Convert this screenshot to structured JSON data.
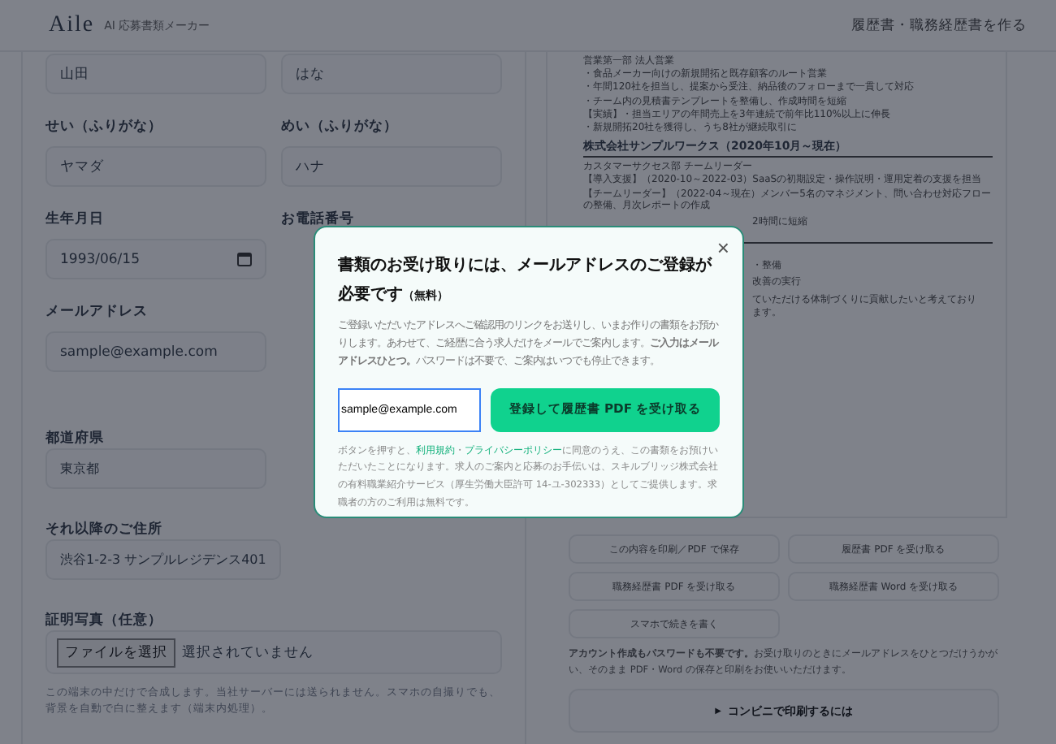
{
  "header": {
    "logo": "Aile",
    "tagline": "AI 応募書類メーカー",
    "nav_link": "履歴書・職務経歴書を作る"
  },
  "form": {
    "top_fields": [
      {
        "value": "山田"
      },
      {
        "value": "はな"
      }
    ],
    "rows": [
      {
        "label": "せい（ふりがな）",
        "value": "ヤマダ",
        "label2": "めい（ふりがな）",
        "value2": "ハナ"
      },
      {
        "label": "生年月日",
        "value": "1993/06/15",
        "kind": "date",
        "label2": "お電話番号"
      },
      {
        "label": "メールアドレス",
        "value": "sample@example.com"
      }
    ],
    "prefecture": {
      "label": "都道府県",
      "value": "東京都"
    },
    "address": {
      "label": "それ以降のご住所",
      "value": "渋谷1-2-3 サンプルレジデンス401"
    },
    "photo": {
      "label": "証明写真（任意）",
      "button": "ファイルを選択",
      "status": "選択されていません",
      "hint": "この端末の中だけで合成します。当社サーバーには送られません。スマホの自撮りでも、背景を自動で白に整えます（端末内処理）。"
    }
  },
  "preview": {
    "lines": [
      {
        "kind": "text",
        "text": "営業第一部 法人営業"
      },
      {
        "kind": "text",
        "text": "・食品メーカー向けの新規開拓と既存顧客のルート営業"
      },
      {
        "kind": "text",
        "text": "・年間120社を担当し、提案から受注、納品後のフォローまで一貫して対応"
      },
      {
        "kind": "text",
        "text": "・チーム内の見積書テンプレートを整備し、作成時間を短縮"
      },
      {
        "kind": "text",
        "text": "【実績】・担当エリアの年間売上を3年連続で前年比110%以上に伸長"
      },
      {
        "kind": "text",
        "text": "・新規開拓20社を獲得し、うち8社が継続取引に"
      },
      {
        "kind": "heading",
        "text": "株式会社サンプルワークス（2020年10月～現在）"
      },
      {
        "kind": "text",
        "text": "カスタマーサクセス部 チームリーダー"
      },
      {
        "kind": "text",
        "text": "【導入支援】（2020-10～2022-03）SaaSの初期設定・操作説明・運用定着の支援を担当"
      },
      {
        "kind": "text",
        "text": "【チームリーダー】（2022-04～現在）メンバー5名のマネジメント、問い合わせ対応フローの整備、月次レポートの作成"
      },
      {
        "kind": "partial",
        "text": "2時間に短縮"
      },
      {
        "kind": "rule"
      },
      {
        "kind": "partial",
        "text": "・整備"
      },
      {
        "kind": "partial",
        "text": "改善の実行"
      },
      {
        "kind": "partial",
        "text": "ていただける体制づくりに貢献したいと考えております。"
      }
    ]
  },
  "actions": [
    {
      "label": "この内容を印刷／PDF で保存"
    },
    {
      "label": "履歴書 PDF を受け取る"
    },
    {
      "label": "職務経歴書 PDF を受け取る"
    },
    {
      "label": "職務経歴書 Word を受け取る"
    },
    {
      "label": "スマホで続きを書く"
    }
  ],
  "account_note": "**アカウント作成もパスワードも不要です。**お受け取りのときにメールアドレスをひとつだけうかがい、そのまま PDF・Word の保存と印刷をお使いいただけます。",
  "konbini": {
    "icon": "▶",
    "label": "コンビニで印刷するには",
    "expanded": false
  },
  "modal": {
    "title": "書類のお受け取りには、メールアドレスのご登録が必要です",
    "title_note": "（無料）",
    "close": "×",
    "body": "ご登録いただいたアドレスへご確認用のリンクをお送りし、いまお作りの書類をお預かりします。あわせて、ご経歴に合う求人だけをメールでご案内します。**ご入力はメールアドレスひとつ。**パスワードは不要で、ご案内はいつでも停止できます。",
    "email": "sample@example.com",
    "submit": "登録して履歴書 PDF を受け取る",
    "legal": [
      {
        "kind": "text",
        "text": "ボタンを押すと、"
      },
      {
        "kind": "link",
        "text": "利用規約"
      },
      {
        "kind": "text",
        "text": "・"
      },
      {
        "kind": "link",
        "text": "プライバシーポリシー"
      },
      {
        "kind": "text",
        "text": "に同意のうえ、この書類をお預けいただいたことになります。求人のご案内と応募のお手伝いは、スキルブリッジ株式会社の有料職業紹介サービス（厚生労働大臣許可 14-ユ-302333）としてご提供します。求職者の方のご利用は無料です。"
      }
    ]
  }
}
